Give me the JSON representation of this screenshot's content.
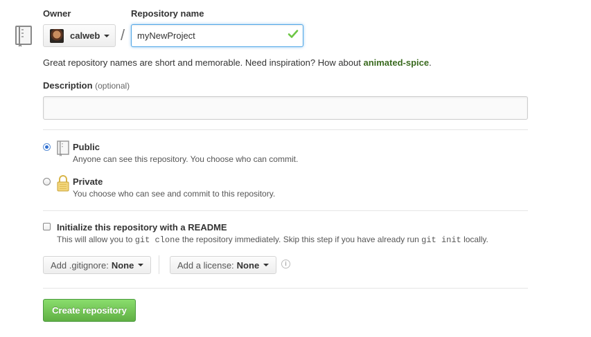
{
  "owner": {
    "label": "Owner",
    "name": "calweb"
  },
  "repo_name": {
    "label": "Repository name",
    "value": "myNewProject",
    "separator": "/"
  },
  "hint": {
    "text": "Great repository names are short and memorable. Need inspiration? How about ",
    "suggestion": "animated-spice",
    "end": "."
  },
  "description": {
    "label": "Description",
    "optional": "(optional)",
    "value": ""
  },
  "visibility": {
    "selected": "public",
    "public": {
      "title": "Public",
      "subtitle": "Anyone can see this repository. You choose who can commit."
    },
    "private": {
      "title": "Private",
      "subtitle": "You choose who can see and commit to this repository."
    }
  },
  "readme": {
    "checked": false,
    "title": "Initialize this repository with a README",
    "sub_prefix": "This will allow you to ",
    "sub_code1": "git clone",
    "sub_middle": " the repository immediately. Skip this step if you have already run ",
    "sub_code2": "git init",
    "sub_suffix": " locally."
  },
  "gitignore": {
    "label": "Add .gitignore:",
    "value": "None"
  },
  "license": {
    "label": "Add a license:",
    "value": "None"
  },
  "info_glyph": "i",
  "submit": {
    "label": "Create repository"
  },
  "colors": {
    "accent_green": "#60b044",
    "suggestion_green": "#3a6a1f",
    "focus_blue": "#51a7e8",
    "check_green": "#6cc644"
  }
}
